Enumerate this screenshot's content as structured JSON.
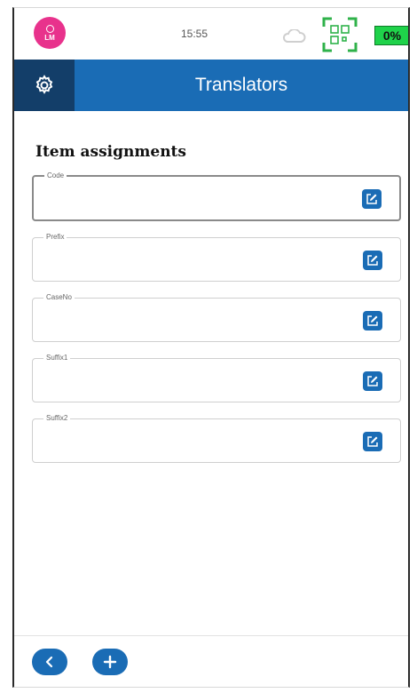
{
  "status_bar": {
    "avatar_initials": "LM",
    "time": "15:55",
    "battery": "0%",
    "icons": [
      "person-icon",
      "cloud-icon",
      "qr-code-icon"
    ]
  },
  "header": {
    "title": "Translators",
    "settings_icon": "gear-icon"
  },
  "section_title": "Item assignments",
  "fields": [
    {
      "label": "Code",
      "value": "",
      "active": true
    },
    {
      "label": "Prefix",
      "value": "",
      "active": false
    },
    {
      "label": "CaseNo",
      "value": "",
      "active": false
    },
    {
      "label": "Suffix1",
      "value": "",
      "active": false
    },
    {
      "label": "Suffix2",
      "value": "",
      "active": false
    }
  ],
  "bottom_bar": {
    "buttons": [
      "back-icon",
      "add-icon"
    ]
  },
  "colors": {
    "primary": "#1a6cb5",
    "header_dark": "#133e69",
    "avatar": "#e8328c",
    "battery": "#1fd24a",
    "qr": "#2fb24a"
  }
}
